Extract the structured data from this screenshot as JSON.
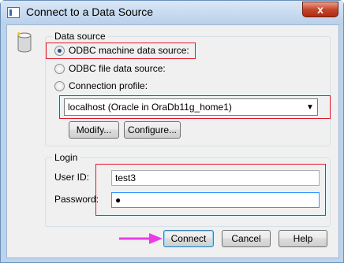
{
  "window": {
    "title": "Connect to a Data Source",
    "close_label": "x"
  },
  "data_source": {
    "group_title": "Data source",
    "options": [
      {
        "label": "ODBC machine data source:",
        "checked": true
      },
      {
        "label": "ODBC file data source:",
        "checked": false
      },
      {
        "label": "Connection profile:",
        "checked": false
      }
    ],
    "profile_value": "localhost (Oracle in OraDb11g_home1)",
    "modify_label": "Modify...",
    "configure_label": "Configure..."
  },
  "login": {
    "group_title": "Login",
    "user_id_label": "User ID:",
    "user_id_value": "test3",
    "password_label": "Password:",
    "password_value": "●"
  },
  "buttons": {
    "connect": "Connect",
    "cancel": "Cancel",
    "help": "Help"
  },
  "colors": {
    "highlight": "#e0182b",
    "pointer": "#e83ce8"
  },
  "icons": {
    "app": "window-icon",
    "db": "database-icon",
    "dropdown": "chevron-down-icon",
    "pointer": "arrow-pointer-icon"
  }
}
